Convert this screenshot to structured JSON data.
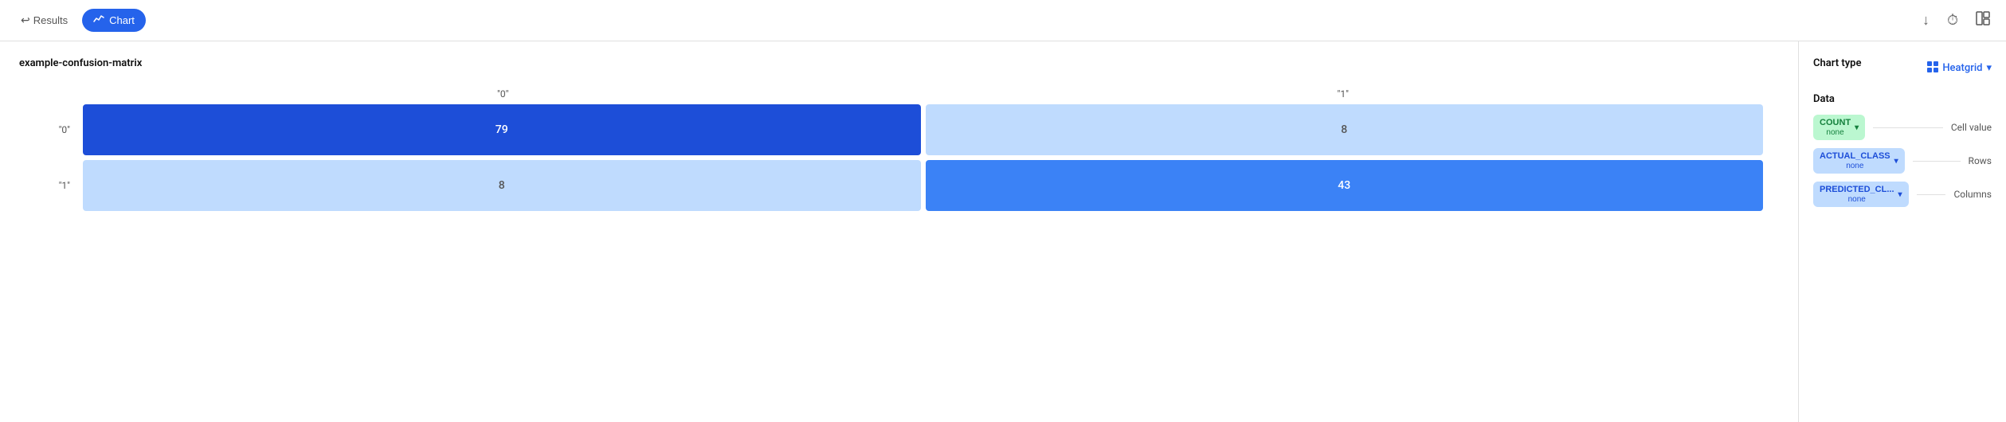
{
  "topbar": {
    "results_label": "Results",
    "chart_label": "Chart",
    "download_icon": "↓",
    "history_icon": "⏱",
    "layout_icon": "⊞"
  },
  "chart": {
    "title": "example-confusion-matrix",
    "column_labels": [
      "\"0\"",
      "\"1\""
    ],
    "rows": [
      {
        "label": "\"0\"",
        "cells": [
          {
            "value": "79",
            "type": "dark"
          },
          {
            "value": "8",
            "type": "light"
          }
        ]
      },
      {
        "label": "\"1\"",
        "cells": [
          {
            "value": "8",
            "type": "light"
          },
          {
            "value": "43",
            "type": "mid"
          }
        ]
      }
    ]
  },
  "sidebar": {
    "chart_type_label": "Chart type",
    "heatgrid_label": "Heatgrid",
    "data_label": "Data",
    "data_rows": [
      {
        "badge_label": "COUNT",
        "badge_sub": "none",
        "badge_type": "green",
        "field_label": "Cell value"
      },
      {
        "badge_label": "ACTUAL_CLASS",
        "badge_sub": "none",
        "badge_type": "blue",
        "field_label": "Rows"
      },
      {
        "badge_label": "PREDICTED_CL...",
        "badge_sub": "none",
        "badge_type": "blue",
        "field_label": "Columns"
      }
    ]
  }
}
